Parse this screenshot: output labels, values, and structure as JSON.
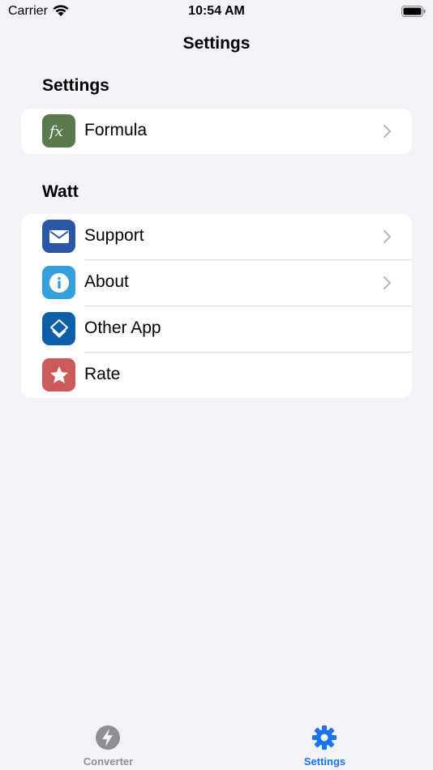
{
  "status_bar": {
    "carrier": "Carrier",
    "time": "10:54 AM"
  },
  "nav": {
    "title": "Settings"
  },
  "sections": [
    {
      "header": "Settings",
      "items": [
        {
          "label": "Formula",
          "icon": "function-icon",
          "icon_color": "#5a7a4e",
          "chevron": true
        }
      ]
    },
    {
      "header": "Watt",
      "items": [
        {
          "label": "Support",
          "icon": "envelope-icon",
          "icon_color": "#2b56a6",
          "chevron": true
        },
        {
          "label": "About",
          "icon": "info-icon",
          "icon_color": "#36a0dc",
          "chevron": true
        },
        {
          "label": "Other App",
          "icon": "layers-icon",
          "icon_color": "#0d5fa8",
          "chevron": false
        },
        {
          "label": "Rate",
          "icon": "star-icon",
          "icon_color": "#cc5a5a",
          "chevron": false
        }
      ]
    }
  ],
  "tab_bar": {
    "tabs": [
      {
        "label": "Converter",
        "icon": "bolt-icon",
        "color": "#8e8e93",
        "active": false
      },
      {
        "label": "Settings",
        "icon": "gear-icon",
        "color": "#1a73e8",
        "active": true
      }
    ]
  }
}
